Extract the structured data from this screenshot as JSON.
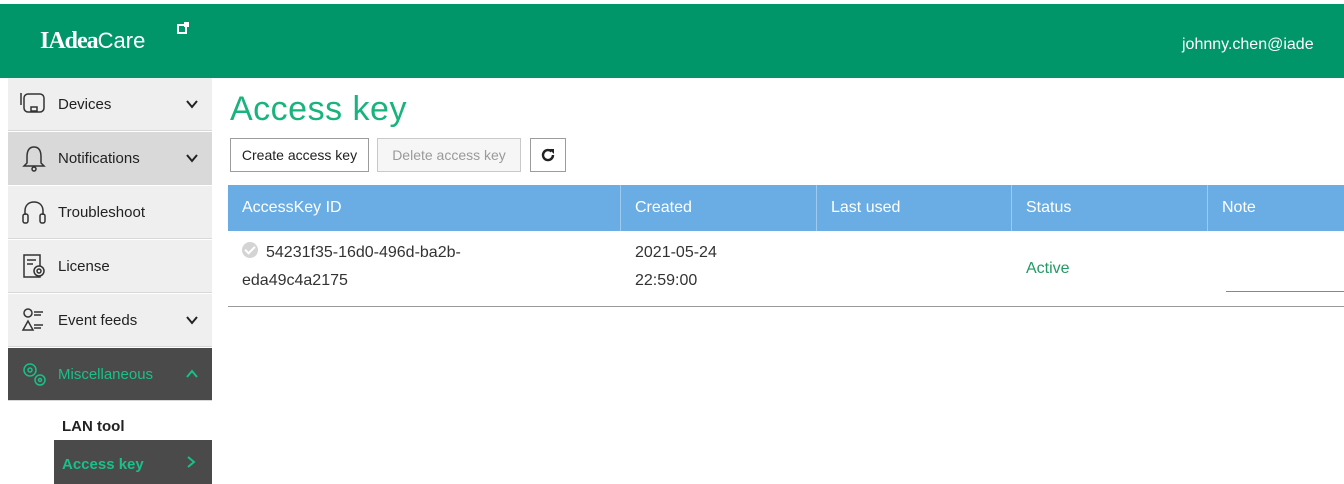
{
  "header": {
    "brand": "IAdea",
    "brand_suffix": "Care",
    "user_email": "johnny.chen@iade"
  },
  "sidebar": {
    "items": [
      {
        "label": "Devices",
        "icon": "device-icon",
        "chevron": "down"
      },
      {
        "label": "Notifications",
        "icon": "bell-icon",
        "chevron": "down"
      },
      {
        "label": "Troubleshoot",
        "icon": "headset-icon"
      },
      {
        "label": "License",
        "icon": "license-icon"
      },
      {
        "label": "Event feeds",
        "icon": "event-feeds-icon",
        "chevron": "down"
      },
      {
        "label": "Miscellaneous",
        "icon": "gears-icon",
        "chevron": "up"
      }
    ],
    "sub_items": [
      {
        "label": "LAN tool"
      },
      {
        "label": "Access key",
        "chevron": "right"
      }
    ]
  },
  "main": {
    "title": "Access key",
    "toolbar": {
      "create_label": "Create access key",
      "delete_label": "Delete access key",
      "refresh_icon": "refresh-icon"
    },
    "table": {
      "columns": [
        "AccessKey ID",
        "Created",
        "Last used",
        "Status",
        "Note"
      ],
      "rows": [
        {
          "id_line1": "54231f35-16d0-496d-ba2b-",
          "id_line2": "eda49c4a2175",
          "created_line1": "2021-05-24",
          "created_line2": "22:59:00",
          "last_used": "",
          "status": "Active",
          "note": ""
        }
      ]
    }
  },
  "colors": {
    "header_bg": "#00966a",
    "accent": "#19b37c",
    "table_header_bg": "#6aade4",
    "active_nav_bg": "#4a4a4a",
    "status_active": "#219a63"
  }
}
